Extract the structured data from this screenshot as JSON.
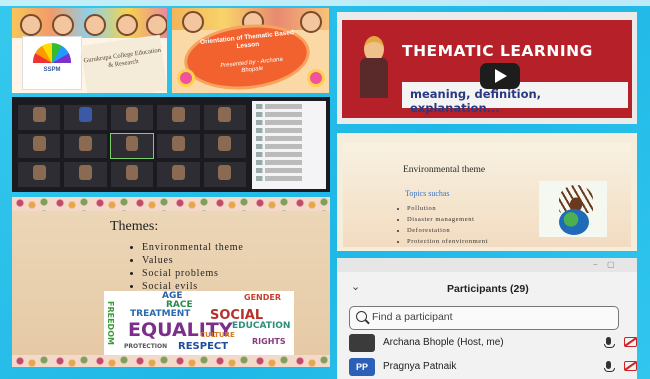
{
  "panels": {
    "college": {
      "logo_text": "SSPM",
      "card_text": "Gurukrupa College Education & Research"
    },
    "orientation": {
      "line1": "Orientation of Thematic Based Lesson",
      "line2": "Presented by - Archana Bhopale"
    },
    "video": {
      "title": "THEMATIC LEARNING",
      "subtitle": "meaning, definition, explanation..."
    },
    "environment": {
      "title": "Environmental theme",
      "topics_label": "Topics suchas",
      "topics": [
        "Pollution",
        "Disaster management",
        "Deforestation",
        "Protection ofenvironment"
      ]
    },
    "themes": {
      "title": "Themes:",
      "items": [
        "Environmental theme",
        "Values",
        "Social problems",
        "Social evils"
      ],
      "wordcloud": [
        "AGE",
        "RACE",
        "GENDER",
        "SOCIAL",
        "EQUALITY",
        "TREATMENT",
        "EDUCATION",
        "RESPECT",
        "FREEDOM",
        "CULTURE",
        "PROTECTION",
        "RIGHTS"
      ]
    },
    "participants": {
      "title": "Participants (29)",
      "search_placeholder": "Find a participant",
      "list": [
        {
          "initials": "",
          "name": "Archana Bhople (Host, me)"
        },
        {
          "initials": "PP",
          "name": "Pragnya Patnaik"
        }
      ]
    }
  },
  "colors": {
    "frame": "#1fb7e6",
    "video_bg": "#b62028",
    "orientation_blob": "#f2622e",
    "topics_blue": "#3b74c9"
  }
}
